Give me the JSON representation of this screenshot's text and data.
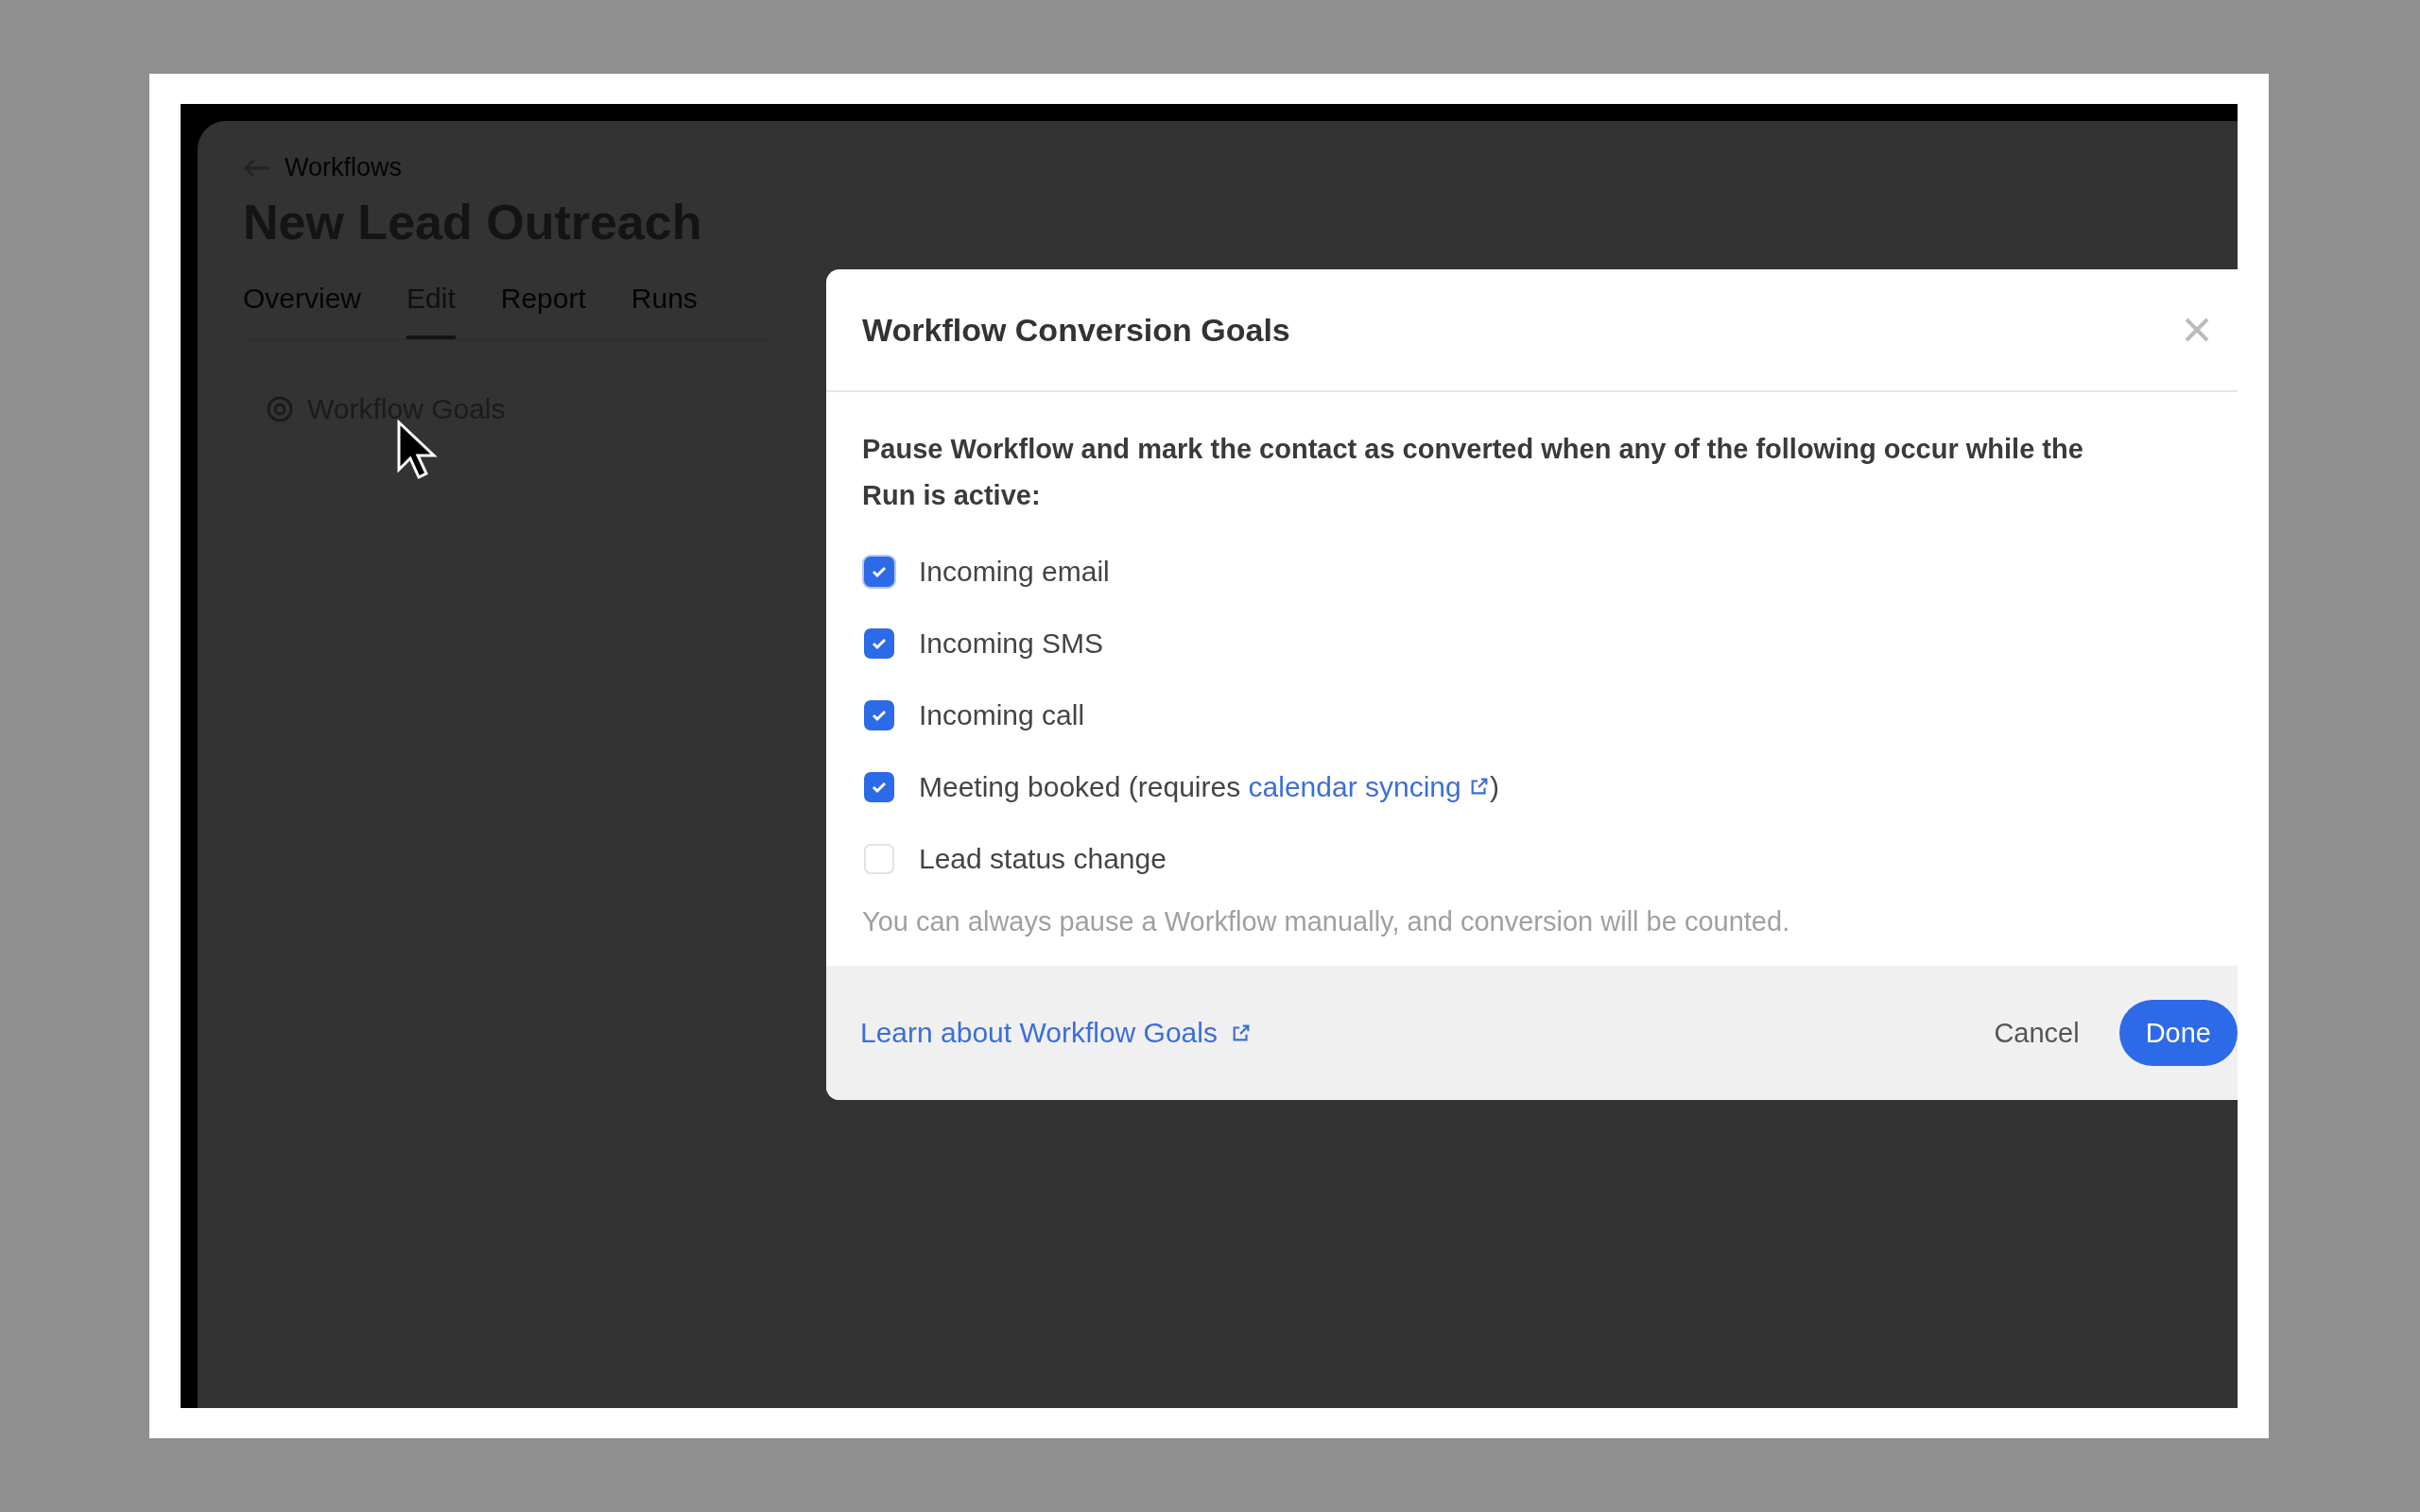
{
  "page": {
    "back_label": "Workflows",
    "title": "New Lead Outreach",
    "tabs": [
      {
        "label": "Overview",
        "selected": false
      },
      {
        "label": "Edit",
        "selected": true
      },
      {
        "label": "Report",
        "selected": false
      },
      {
        "label": "Runs",
        "selected": false
      }
    ],
    "goals_item": "Workflow Goals"
  },
  "dialog": {
    "title": "Workflow Conversion Goals",
    "intro": "Pause Workflow and mark the contact as converted when any of the following occur while the Run is active:",
    "options": [
      {
        "label": "Incoming email",
        "checked": true,
        "focused": true
      },
      {
        "label": "Incoming SMS",
        "checked": true,
        "focused": false
      },
      {
        "label": "Incoming call",
        "checked": true,
        "focused": false
      },
      {
        "label": "Meeting booked (requires",
        "link": "calendar syncing",
        "suffix": ")",
        "checked": true,
        "focused": false
      },
      {
        "label": "Lead status change",
        "checked": false,
        "focused": false
      }
    ],
    "note": "You can always pause a Workflow manually, and conversion will be counted.",
    "footer_link": "Learn about Workflow Goals",
    "buttons": [
      {
        "label": "Cancel",
        "kind": "secondary"
      },
      {
        "label": "Done",
        "kind": "primary"
      }
    ]
  }
}
